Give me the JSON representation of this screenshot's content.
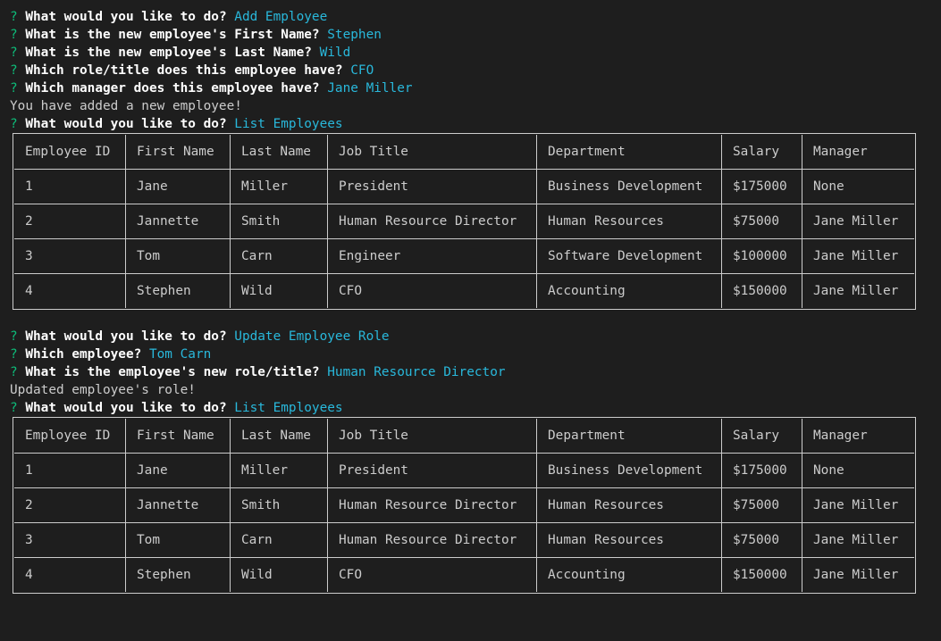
{
  "session1": {
    "prompts": [
      {
        "q": "?",
        "prompt": "What would you like to do?",
        "answer": "Add Employee"
      },
      {
        "q": "?",
        "prompt": "What is the new employee's First Name?",
        "answer": "Stephen"
      },
      {
        "q": "?",
        "prompt": "What is the new employee's Last Name?",
        "answer": "Wild"
      },
      {
        "q": "?",
        "prompt": "Which role/title does this employee have?",
        "answer": "CFO"
      },
      {
        "q": "?",
        "prompt": "Which manager does this employee have?",
        "answer": "Jane Miller"
      }
    ],
    "message": "You have added a new employee!",
    "next": {
      "q": "?",
      "prompt": "What would you like to do?",
      "answer": "List Employees"
    }
  },
  "table1": {
    "headers": [
      "Employee ID",
      "First Name",
      "Last Name",
      "Job Title",
      "Department",
      "Salary",
      "Manager"
    ],
    "rows": [
      [
        "1",
        "Jane",
        "Miller",
        "President",
        "Business Development",
        "$175000",
        "None"
      ],
      [
        "2",
        "Jannette",
        "Smith",
        "Human Resource Director",
        "Human Resources",
        "$75000",
        "Jane Miller"
      ],
      [
        "3",
        "Tom",
        "Carn",
        "Engineer",
        "Software Development",
        "$100000",
        "Jane Miller"
      ],
      [
        "4",
        "Stephen",
        "Wild",
        "CFO",
        "Accounting",
        "$150000",
        "Jane Miller"
      ]
    ]
  },
  "session2": {
    "prompts": [
      {
        "q": "?",
        "prompt": "What would you like to do?",
        "answer": "Update Employee Role"
      },
      {
        "q": "?",
        "prompt": "Which employee?",
        "answer": "Tom Carn"
      },
      {
        "q": "?",
        "prompt": "What is the employee's new role/title?",
        "answer": "Human Resource Director"
      }
    ],
    "message": "Updated employee's role!",
    "next": {
      "q": "?",
      "prompt": "What would you like to do?",
      "answer": "List Employees"
    }
  },
  "table2": {
    "headers": [
      "Employee ID",
      "First Name",
      "Last Name",
      "Job Title",
      "Department",
      "Salary",
      "Manager"
    ],
    "rows": [
      [
        "1",
        "Jane",
        "Miller",
        "President",
        "Business Development",
        "$175000",
        "None"
      ],
      [
        "2",
        "Jannette",
        "Smith",
        "Human Resource Director",
        "Human Resources",
        "$75000",
        "Jane Miller"
      ],
      [
        "3",
        "Tom",
        "Carn",
        "Human Resource Director",
        "Human Resources",
        "$75000",
        "Jane Miller"
      ],
      [
        "4",
        "Stephen",
        "Wild",
        "CFO",
        "Accounting",
        "$150000",
        "Jane Miller"
      ]
    ]
  },
  "colors": {
    "background": "#1e1e1e",
    "question_mark": "#0dbc79",
    "prompt_text": "#ffffff",
    "answer_text": "#29b8db",
    "output_text": "#cccccc"
  }
}
